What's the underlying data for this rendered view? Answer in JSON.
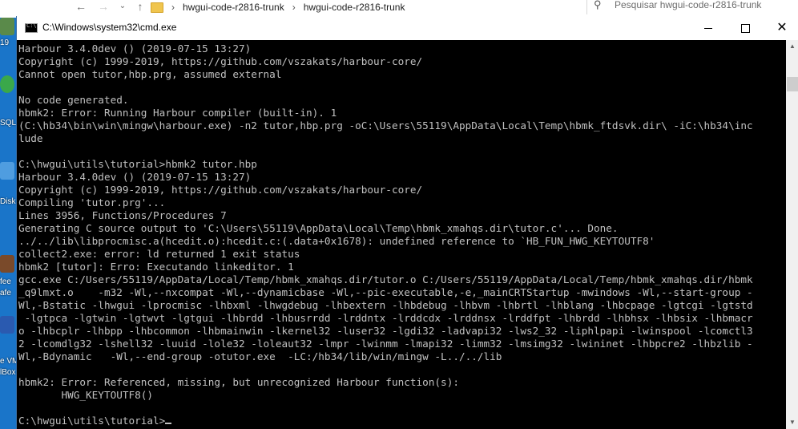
{
  "explorer": {
    "breadcrumb": [
      "hwgui-code-r2816-trunk",
      "hwgui-code-r2816-trunk"
    ],
    "search_placeholder": "Pesquisar hwgui-code-r2816-trunk"
  },
  "desktop": {
    "labels": [
      "19",
      "SQL",
      "Disk",
      "fee",
      "afe",
      "e VM",
      "lBox"
    ]
  },
  "window": {
    "title": "C:\\Windows\\system32\\cmd.exe"
  },
  "console": {
    "lines": [
      "Harbour 3.4.0dev () (2019-07-15 13:27)",
      "Copyright (c) 1999-2019, https://github.com/vszakats/harbour-core/",
      "Cannot open tutor,hbp.prg, assumed external",
      "",
      "No code generated.",
      "hbmk2: Error: Running Harbour compiler (built-in). 1",
      "(C:\\hb34\\bin\\win\\mingw\\harbour.exe) -n2 tutor,hbp.prg -oC:\\Users\\55119\\AppData\\Local\\Temp\\hbmk_ftdsvk.dir\\ -iC:\\hb34\\inc",
      "lude",
      "",
      "C:\\hwgui\\utils\\tutorial>hbmk2 tutor.hbp",
      "Harbour 3.4.0dev () (2019-07-15 13:27)",
      "Copyright (c) 1999-2019, https://github.com/vszakats/harbour-core/",
      "Compiling 'tutor.prg'...",
      "Lines 3956, Functions/Procedures 7",
      "Generating C source output to 'C:\\Users\\55119\\AppData\\Local\\Temp\\hbmk_xmahqs.dir\\tutor.c'... Done.",
      "../../lib\\libprocmisc.a(hcedit.o):hcedit.c:(.data+0x1678): undefined reference to `HB_FUN_HWG_KEYTOUTF8'",
      "collect2.exe: error: ld returned 1 exit status",
      "hbmk2 [tutor]: Erro: Executando linkeditor. 1",
      "gcc.exe C:/Users/55119/AppData/Local/Temp/hbmk_xmahqs.dir/tutor.o C:/Users/55119/AppData/Local/Temp/hbmk_xmahqs.dir/hbmk",
      "_q9lmxt.o    -m32 -Wl,--nxcompat -Wl,--dynamicbase -Wl,--pic-executable,-e,_mainCRTStartup -mwindows -Wl,--start-group -",
      "Wl,-Bstatic -lhwgui -lprocmisc -lhbxml -lhwgdebug -lhbextern -lhbdebug -lhbvm -lhbrtl -lhblang -lhbcpage -lgtcgi -lgtstd",
      " -lgtpca -lgtwin -lgtwvt -lgtgui -lhbrdd -lhbusrrdd -lrddntx -lrddcdx -lrddnsx -lrddfpt -lhbrdd -lhbhsx -lhbsix -lhbmacr",
      "o -lhbcplr -lhbpp -lhbcommon -lhbmainwin -lkernel32 -luser32 -lgdi32 -ladvapi32 -lws2_32 -liphlpapi -lwinspool -lcomctl3",
      "2 -lcomdlg32 -lshell32 -luuid -lole32 -loleaut32 -lmpr -lwinmm -lmapi32 -limm32 -lmsimg32 -lwininet -lhbpcre2 -lhbzlib -",
      "Wl,-Bdynamic   -Wl,--end-group -otutor.exe  -LC:/hb34/lib/win/mingw -L../../lib",
      "",
      "hbmk2: Error: Referenced, missing, but unrecognized Harbour function(s):",
      "       HWG_KEYTOUTF8()",
      "",
      "C:\\hwgui\\utils\\tutorial>"
    ]
  }
}
